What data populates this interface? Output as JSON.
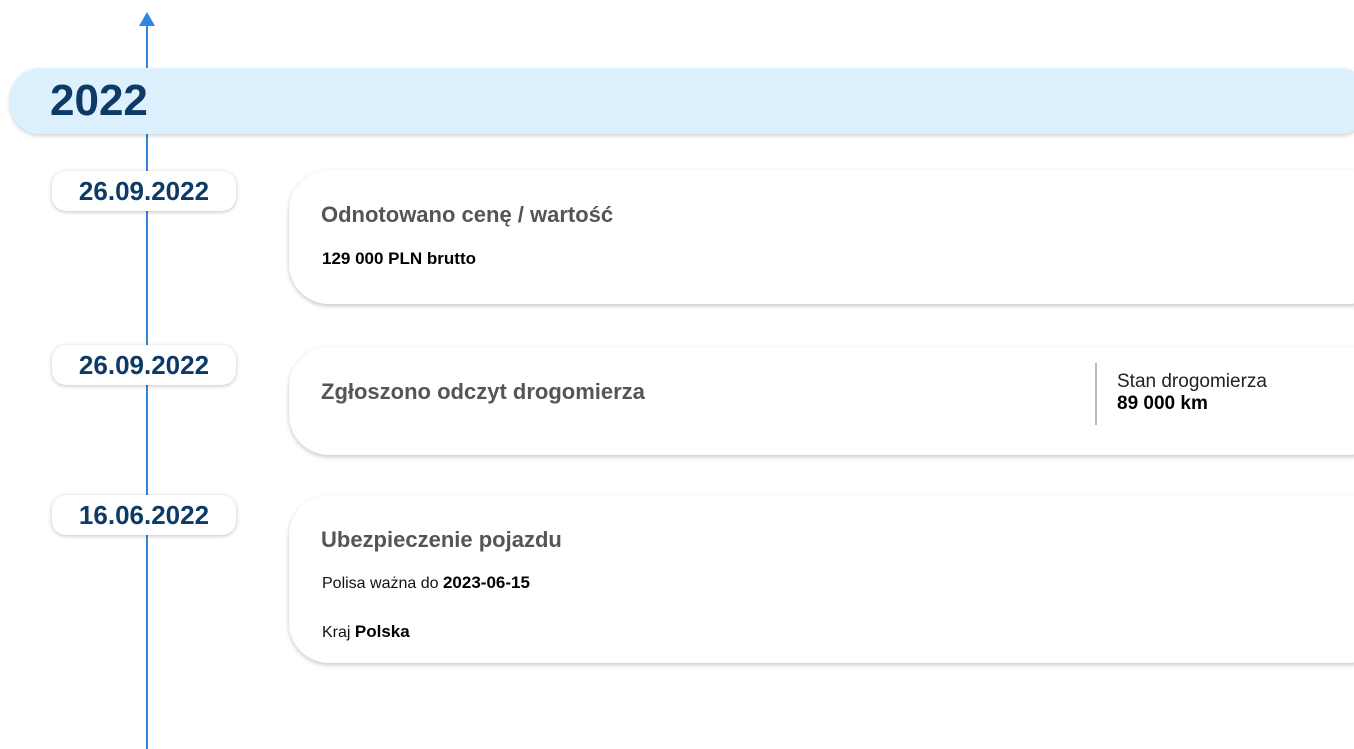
{
  "timeline": {
    "year": "2022",
    "events": [
      {
        "date": "26.09.2022",
        "title": "Odnotowano cenę / wartość",
        "value": "129 000 PLN brutto"
      },
      {
        "date": "26.09.2022",
        "title": "Zgłoszono odczyt drogomierza",
        "odometer_label": "Stan drogomierza",
        "odometer_value": "89 000 km"
      },
      {
        "date": "16.06.2022",
        "title": "Ubezpieczenie pojazdu",
        "policy_label": "Polisa ważna do",
        "policy_value": "2023-06-15",
        "country_label": "Kraj",
        "country_value": "Polska"
      }
    ]
  },
  "colors": {
    "accent": "#2f86e0",
    "year_band": "#dcf1fd",
    "date_text": "#0d3a66",
    "title_text": "#555555"
  }
}
